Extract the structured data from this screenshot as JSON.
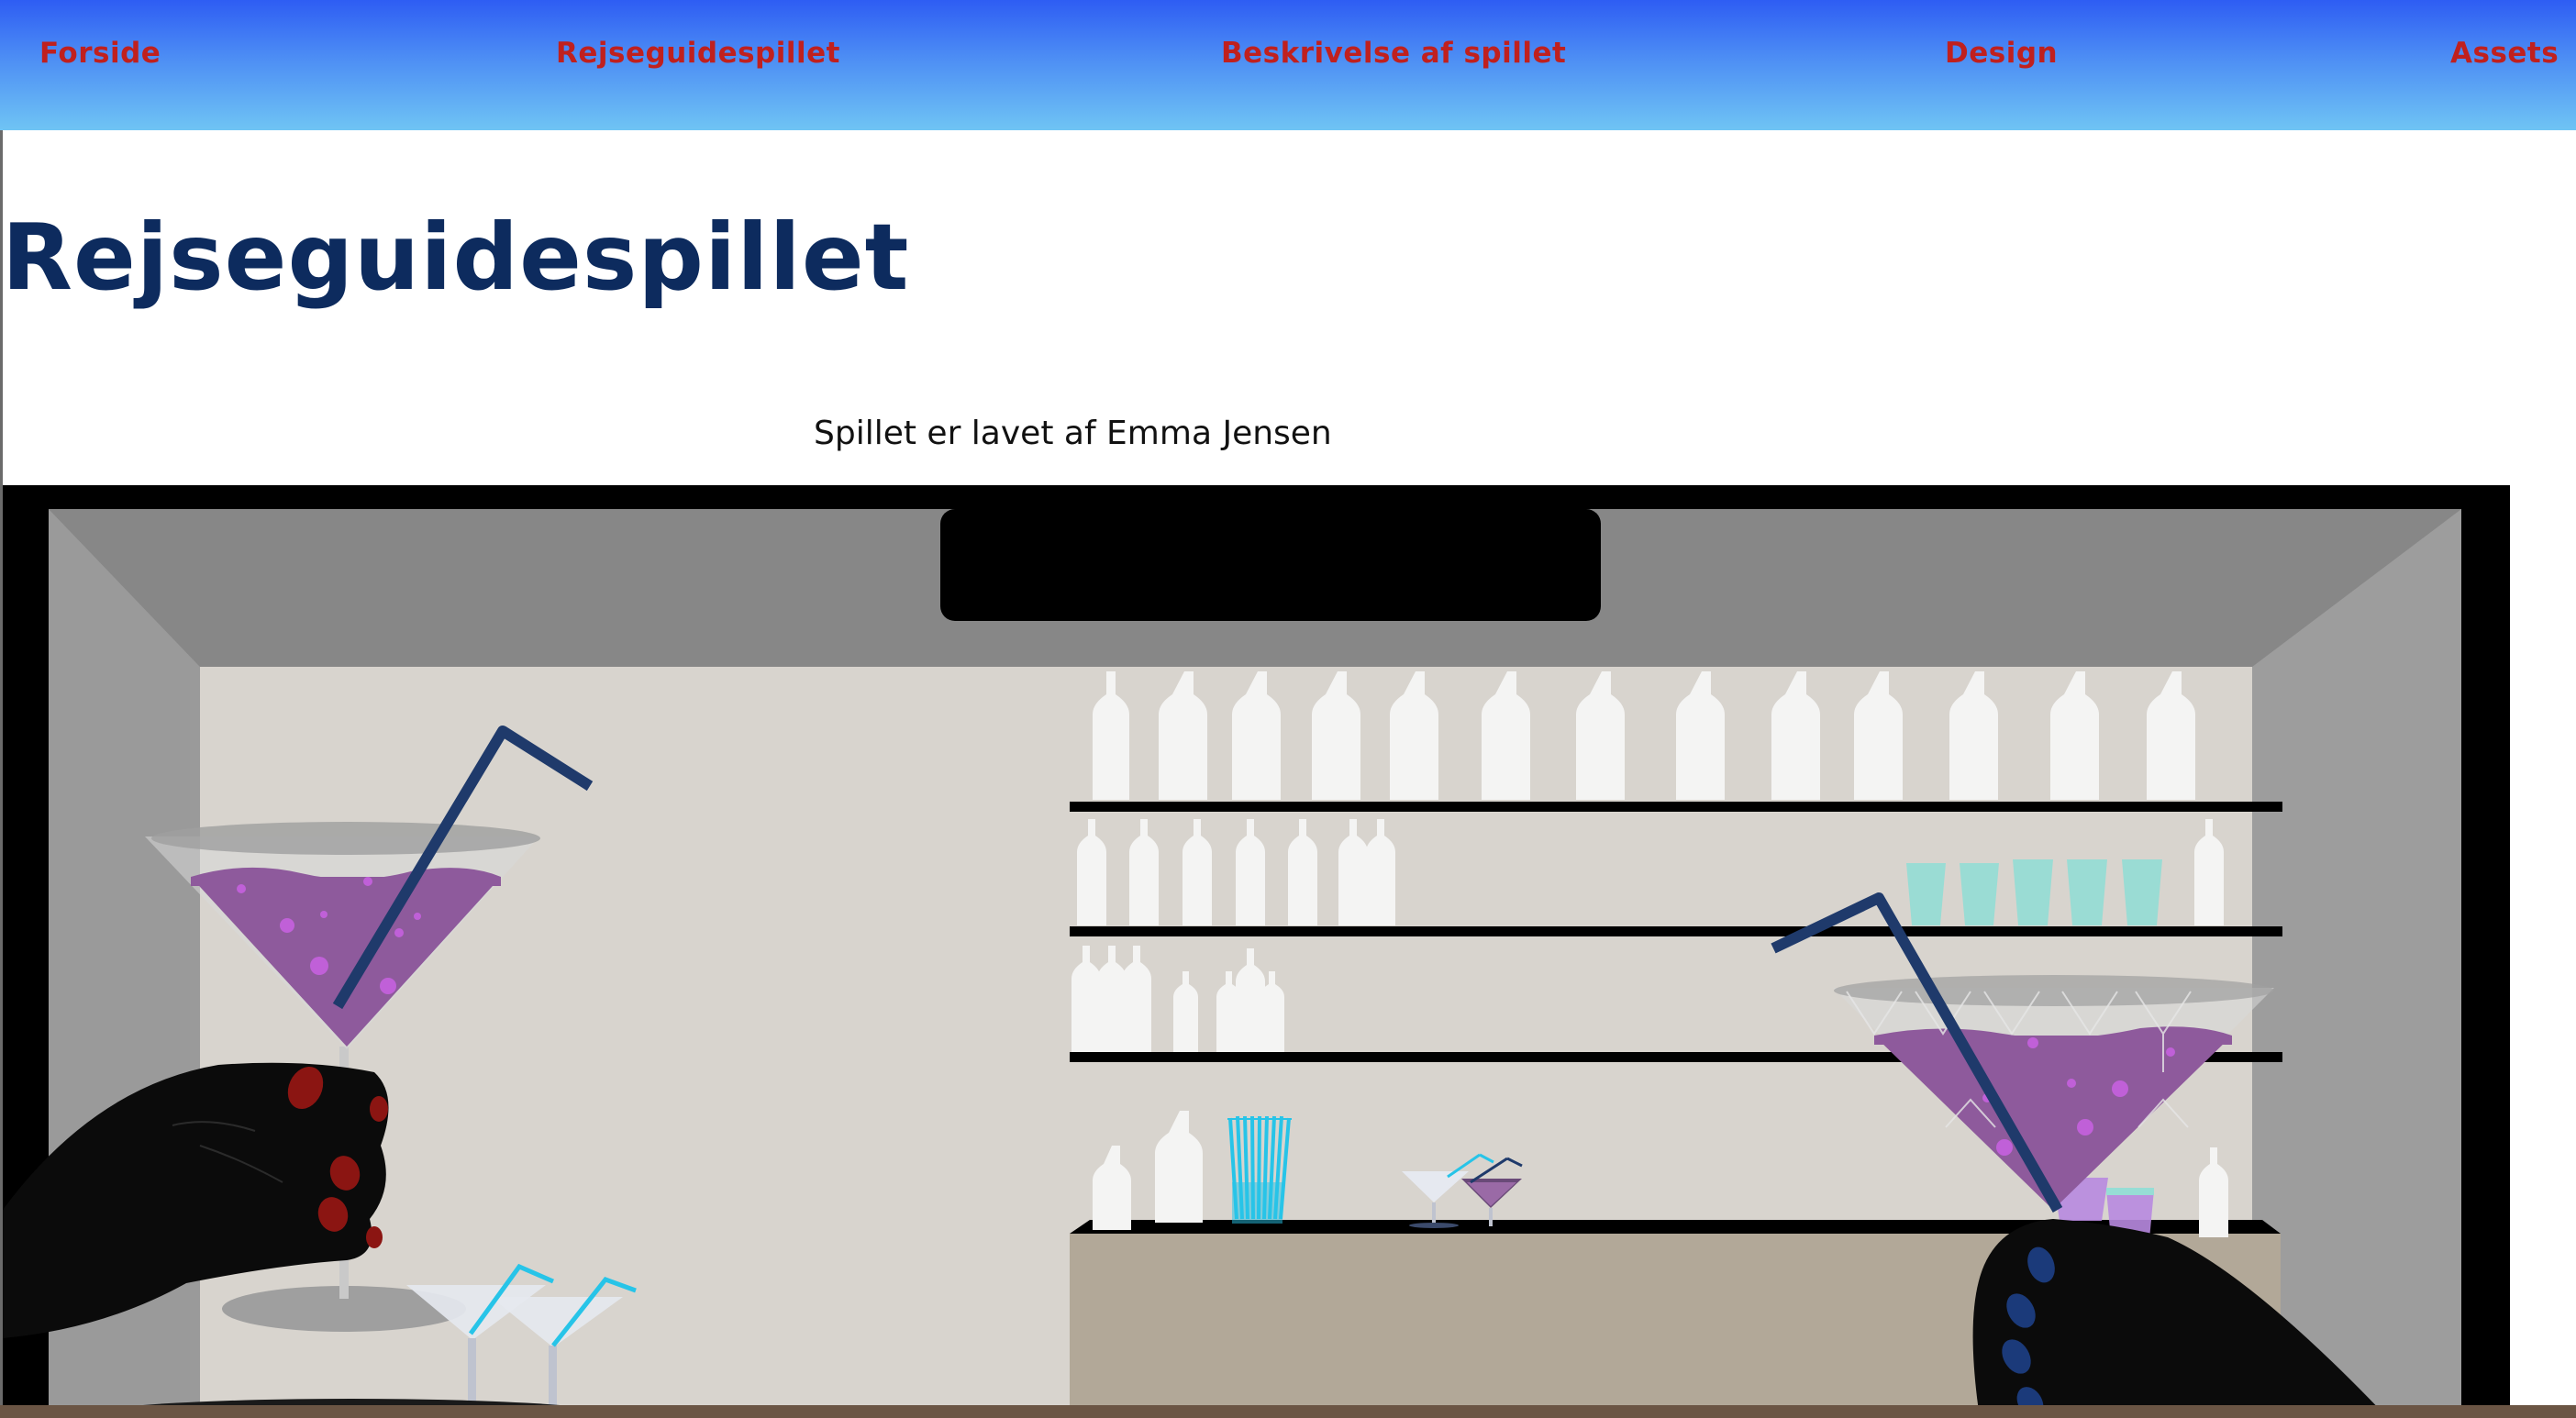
{
  "nav": {
    "items": [
      {
        "label": "Forside"
      },
      {
        "label": "Rejseguidespillet"
      },
      {
        "label": "Beskrivelse af spillet"
      },
      {
        "label": "Design"
      },
      {
        "label": "Assets"
      }
    ],
    "colors": {
      "gradient_top": "#2e5df3",
      "gradient_bottom": "#6fc4f4",
      "link": "#c0201e"
    }
  },
  "main": {
    "title": "Rejseguidespillet",
    "byline": "Spillet er lavet af Emma Jensen"
  },
  "game": {
    "scene": "bar-interior",
    "colors": {
      "title": "#0d2b5e",
      "drink": "#8e5a9c",
      "straw": "#1f3a6b",
      "counter": "#b2a898"
    }
  }
}
